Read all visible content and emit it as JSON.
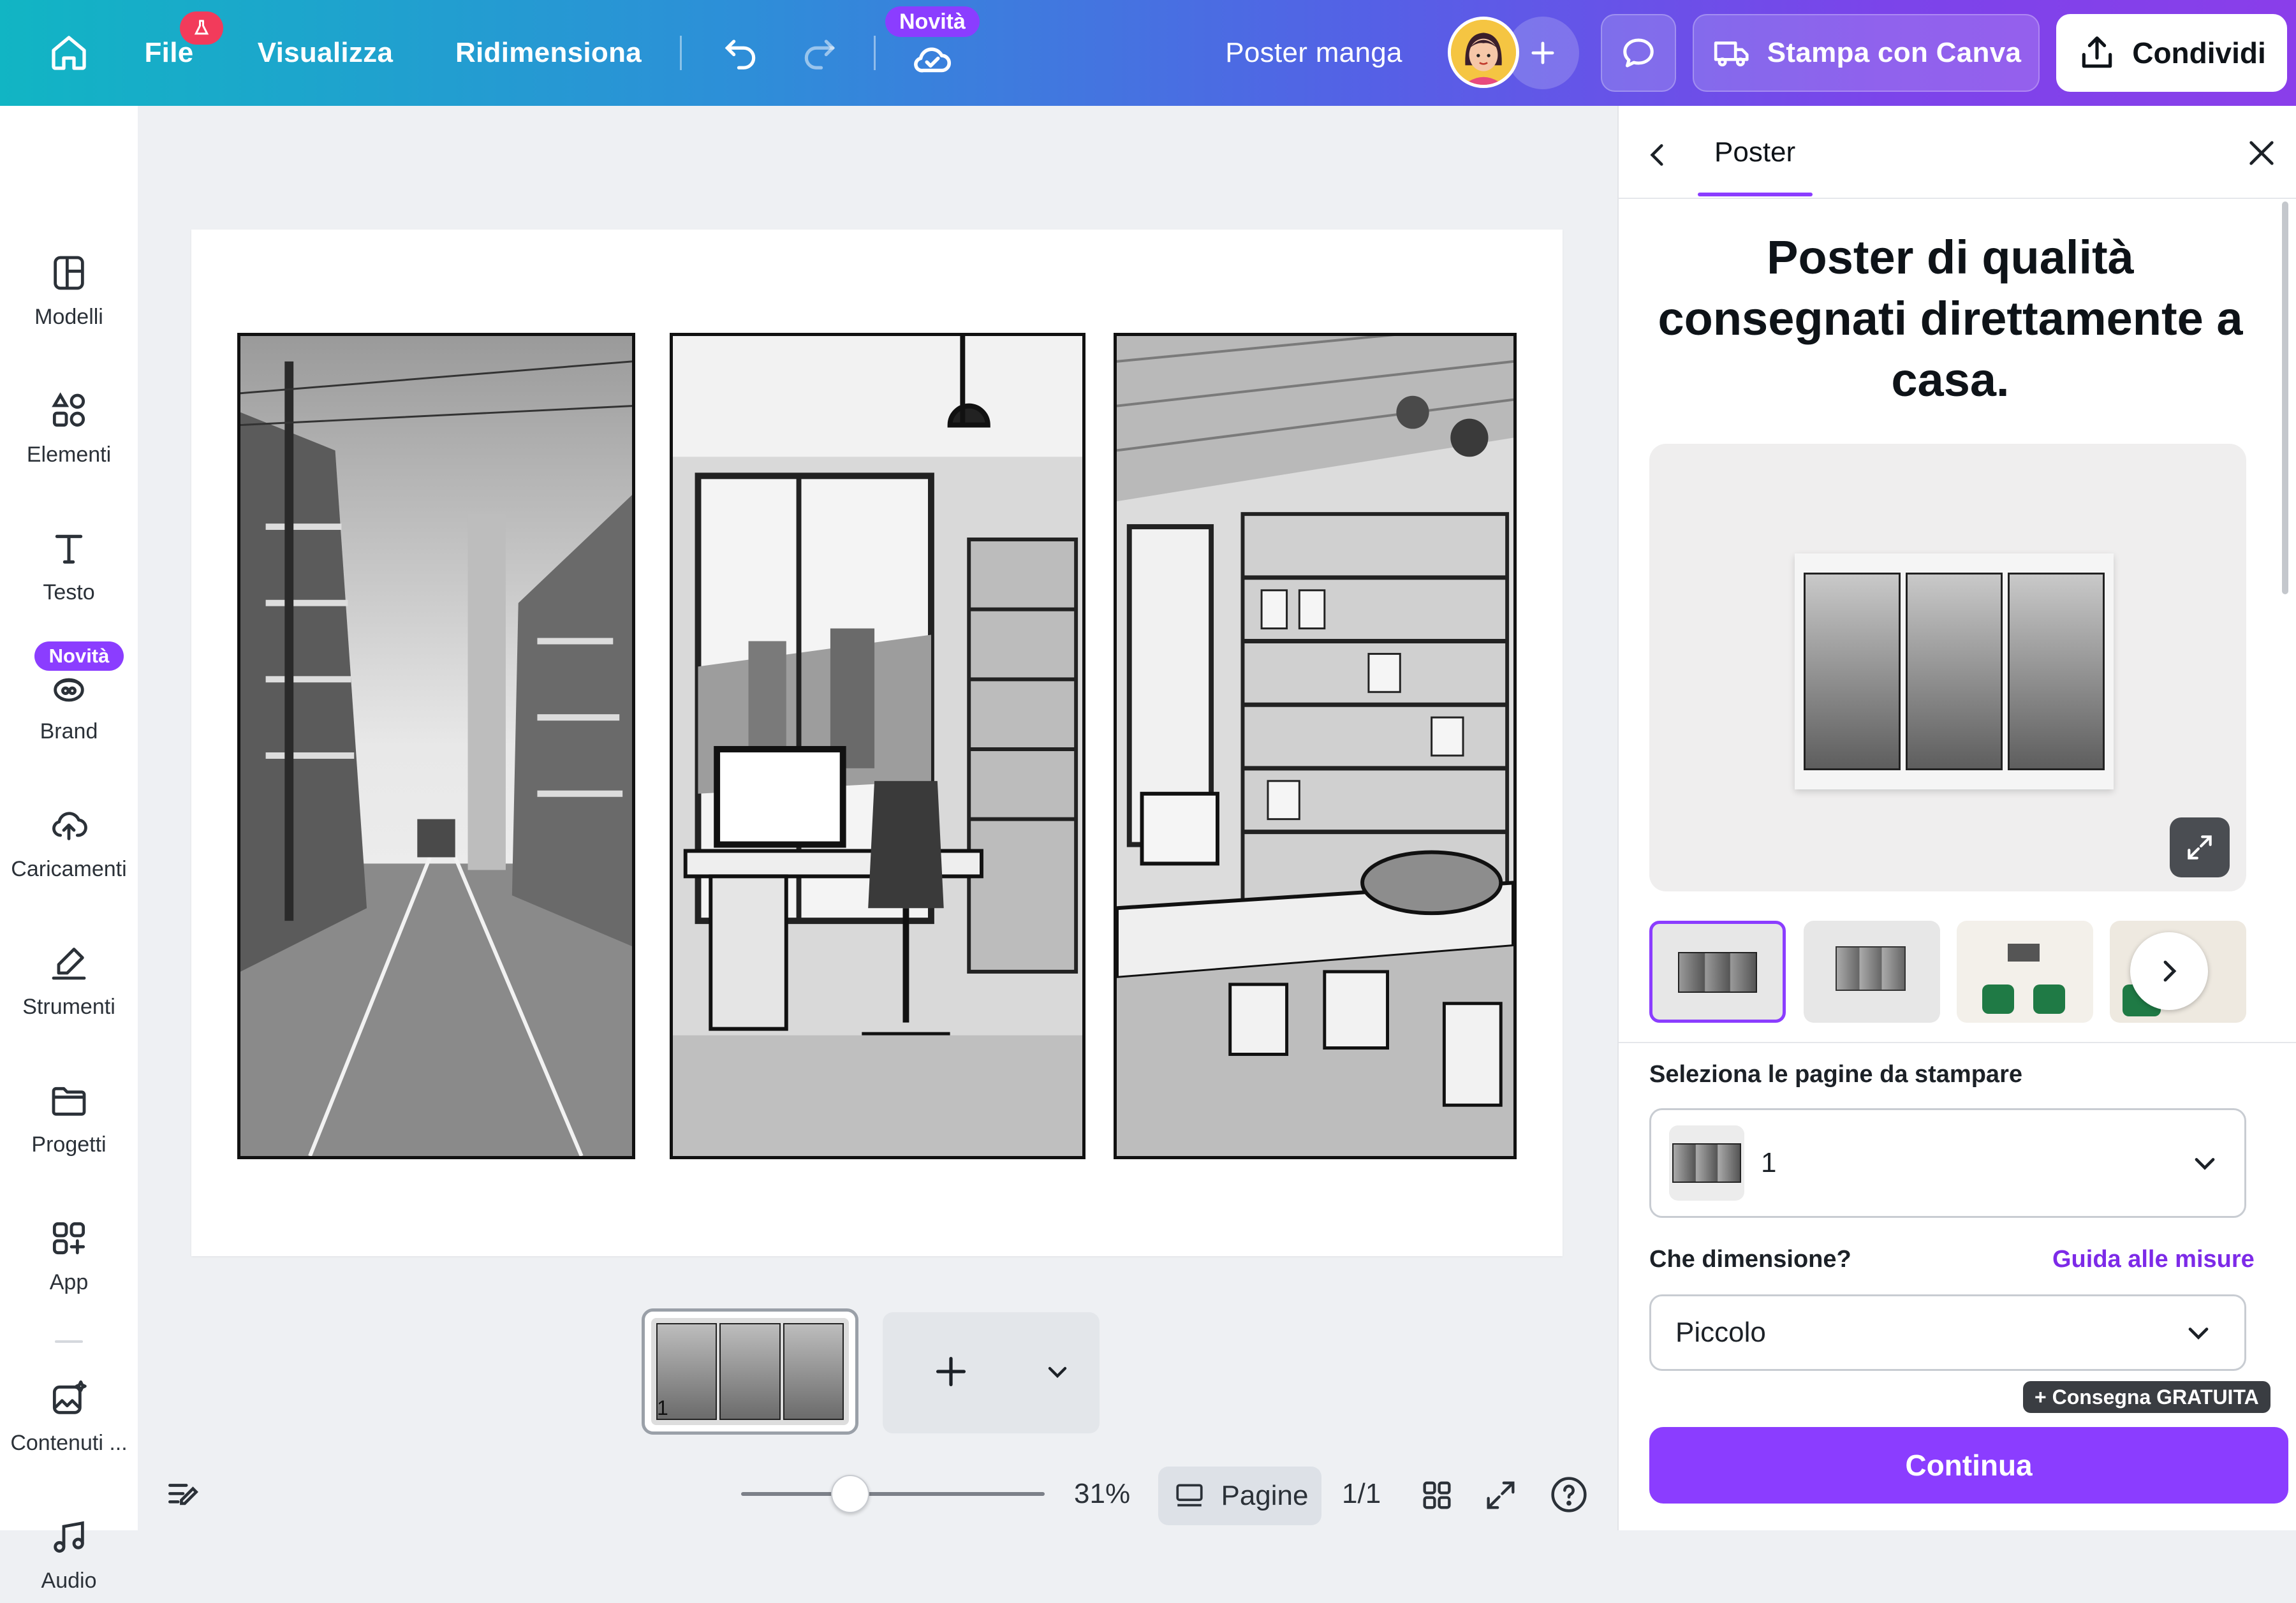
{
  "topbar": {
    "file_label": "File",
    "view_label": "Visualizza",
    "resize_label": "Ridimensiona",
    "new_badge": "Novità",
    "doc_title": "Poster manga",
    "print_label": "Stampa con Canva",
    "share_label": "Condividi"
  },
  "sidebar": {
    "items": [
      {
        "label": "Modelli"
      },
      {
        "label": "Elementi"
      },
      {
        "label": "Testo"
      },
      {
        "label": "Brand"
      },
      {
        "label": "Caricamenti"
      },
      {
        "label": "Strumenti"
      },
      {
        "label": "Progetti"
      },
      {
        "label": "App"
      },
      {
        "label": "Contenuti ..."
      },
      {
        "label": "Audio"
      }
    ],
    "new_badge": "Novità"
  },
  "footer": {
    "page_number": "1",
    "zoom": "31%",
    "zoom_fraction": 0.31,
    "pages_label": "Pagine",
    "page_count": "1/1"
  },
  "panel": {
    "tab_label": "Poster",
    "headline": "Poster di qualità consegnati direttamente a casa.",
    "pages_label": "Seleziona le pagine da stampare",
    "pages_value": "1",
    "size_label": "Che dimensione?",
    "size_guide": "Guida alle misure",
    "size_value": "Piccolo",
    "free_delivery": "+ Consegna GRATUITA",
    "continue_label": "Continua"
  },
  "colors": {
    "accent": "#8b3dff",
    "topbar_start": "#11b5c4",
    "topbar_end": "#8a3eea"
  }
}
